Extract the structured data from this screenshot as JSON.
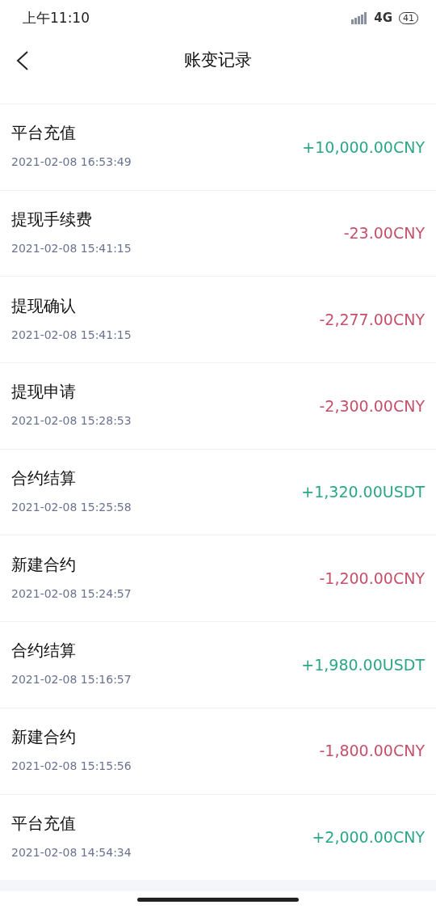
{
  "status_bar": {
    "time": "上午11:10",
    "network": "4G",
    "battery": "41"
  },
  "header": {
    "title": "账变记录"
  },
  "records": [
    {
      "title": "平台充值",
      "time": "2021-02-08 16:53:49",
      "amount": "+10,000.00CNY",
      "kind": "credit"
    },
    {
      "title": "提现手续费",
      "time": "2021-02-08 15:41:15",
      "amount": "-23.00CNY",
      "kind": "debit"
    },
    {
      "title": "提现确认",
      "time": "2021-02-08 15:41:15",
      "amount": "-2,277.00CNY",
      "kind": "debit"
    },
    {
      "title": "提现申请",
      "time": "2021-02-08 15:28:53",
      "amount": "-2,300.00CNY",
      "kind": "debit"
    },
    {
      "title": "合约结算",
      "time": "2021-02-08 15:25:58",
      "amount": "+1,320.00USDT",
      "kind": "credit"
    },
    {
      "title": "新建合约",
      "time": "2021-02-08 15:24:57",
      "amount": "-1,200.00CNY",
      "kind": "debit"
    },
    {
      "title": "合约结算",
      "time": "2021-02-08 15:16:57",
      "amount": "+1,980.00USDT",
      "kind": "credit"
    },
    {
      "title": "新建合约",
      "time": "2021-02-08 15:15:56",
      "amount": "-1,800.00CNY",
      "kind": "debit"
    },
    {
      "title": "平台充值",
      "time": "2021-02-08 14:54:34",
      "amount": "+2,000.00CNY",
      "kind": "credit"
    }
  ]
}
